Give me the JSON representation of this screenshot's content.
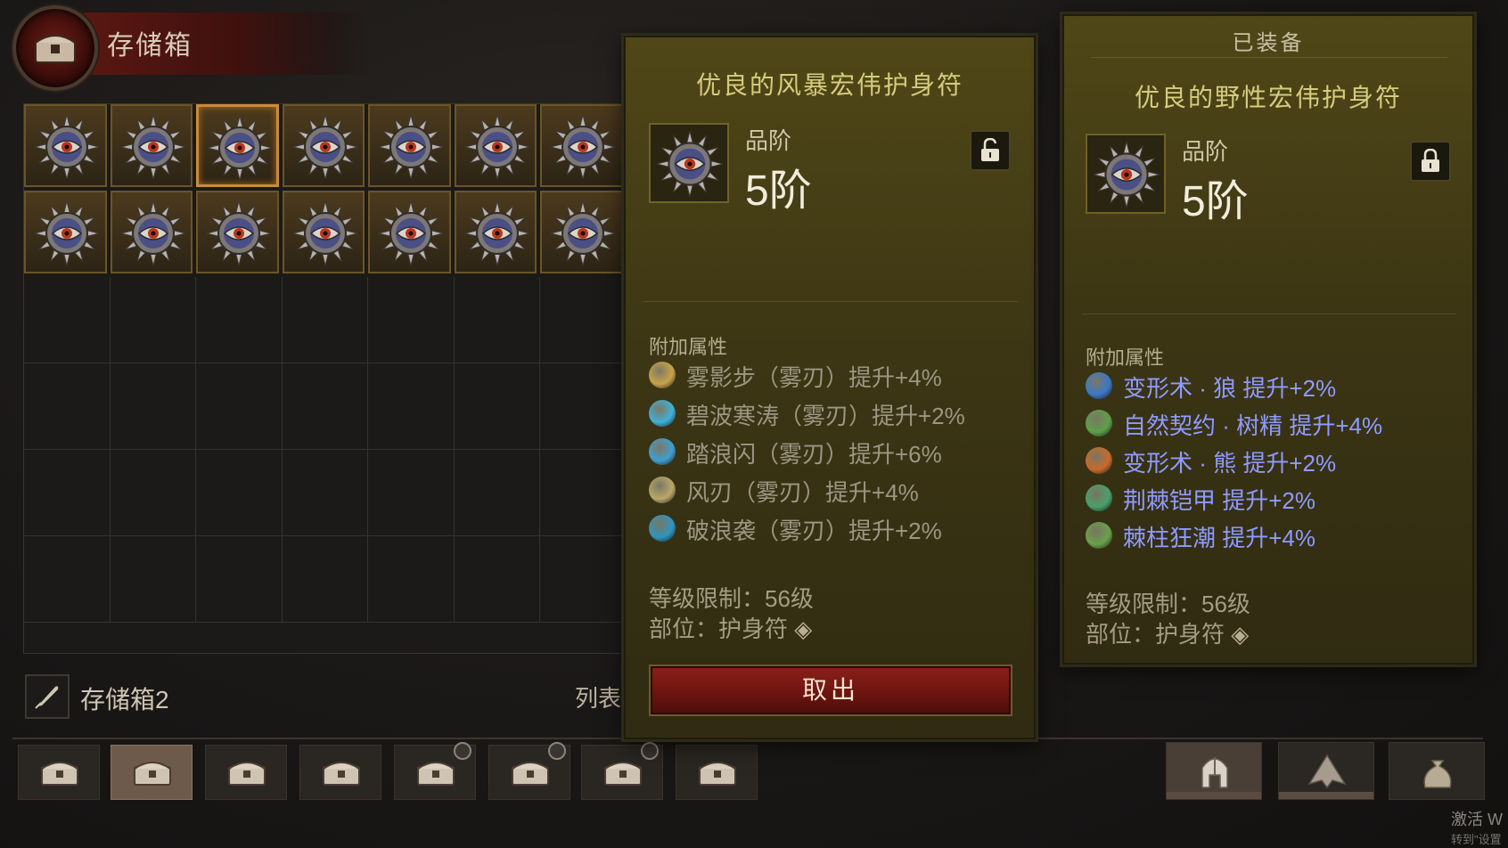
{
  "stash": {
    "title": "存储箱",
    "name": "存储箱2",
    "list_label": "列表"
  },
  "tooltip": {
    "item_name": "优良的风暴宏伟护身符",
    "grade_label": "品阶",
    "grade_value": "5阶",
    "affix_title": "附加属性",
    "affixes": [
      "雾影步（雾刃）提升+4%",
      "碧波寒涛（雾刃）提升+2%",
      "踏浪闪（雾刃）提升+6%",
      "风刃（雾刃）提升+4%",
      "破浪袭（雾刃）提升+2%"
    ],
    "level_req": "等级限制：56级",
    "slot": "部位：护身符",
    "take_out_label": "取出"
  },
  "equipped": {
    "label": "已装备",
    "item_name": "优良的野性宏伟护身符",
    "grade_label": "品阶",
    "grade_value": "5阶",
    "affix_title": "附加属性",
    "affixes": [
      "变形术 · 狼  提升+2%",
      "自然契约 · 树精  提升+4%",
      "变形术 · 熊  提升+2%",
      "荆棘铠甲  提升+2%",
      "棘柱狂潮  提升+4%"
    ],
    "level_req": "等级限制：56级",
    "slot": "部位：护身符"
  },
  "system": {
    "activate_text": "激活 W",
    "activate_sub": "转到\"设置"
  },
  "colors": {
    "panel": "#3c3614",
    "item_name": "#d5cc7e",
    "affix_grey": "#9c9684",
    "affix_blue": "#8f9bff",
    "take_out_button": "#6b1410",
    "selected_cell": "#c98b3a"
  },
  "icons": {
    "stash_emblem": "chest-icon",
    "lock_open": "unlock-icon",
    "lock_closed": "lock-icon",
    "feather": "feather-icon",
    "gear_tabs": [
      "helmet-icon",
      "cloak-icon",
      "bag-icon"
    ]
  }
}
